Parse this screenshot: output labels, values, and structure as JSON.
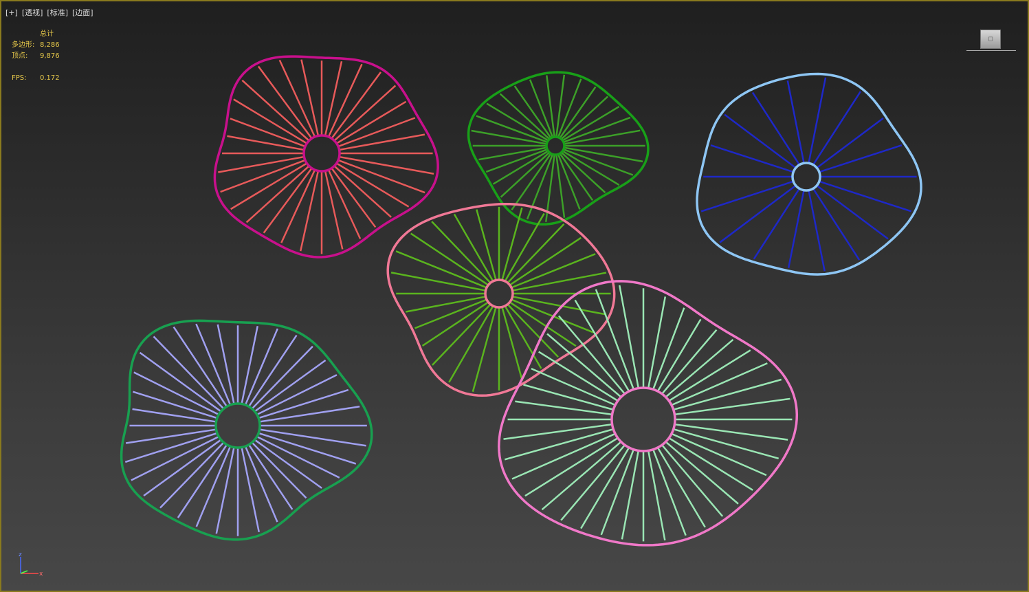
{
  "viewport": {
    "labels": [
      "[+]",
      "[透视]",
      "[标准]",
      "[边面]"
    ],
    "border_color": "#8a7a1e"
  },
  "stats": {
    "header": "总计",
    "polygons_label": "多边形:",
    "polygons_value": "8,286",
    "vertices_label": "顶点:",
    "vertices_value": "9,876",
    "fps_label": "FPS:",
    "fps_value": "0.172",
    "color": "#e6c84a"
  },
  "viewcube": {
    "icon": "viewcube-icon"
  },
  "axis_gizmo": {
    "icon": "axis-tripod-icon",
    "z_label": "z",
    "x_label": "x"
  },
  "objects": [
    {
      "name": "lotus-leaf-red",
      "outline_color": "#c8108c",
      "spoke_color": "#e85a5a",
      "spokes": 32
    },
    {
      "name": "lotus-leaf-green",
      "outline_color": "#18a018",
      "spoke_color": "#3ca028",
      "spokes": 30
    },
    {
      "name": "lotus-leaf-blue",
      "outline_color": "#8ec6f4",
      "spoke_color": "#1e28c8",
      "spokes": 18
    },
    {
      "name": "lotus-leaf-pink",
      "outline_color": "#f07896",
      "spoke_color": "#5ab41e",
      "spokes": 28
    },
    {
      "name": "lotus-leaf-purple",
      "outline_color": "#18a050",
      "spoke_color": "#a0a0f0",
      "spokes": 36
    },
    {
      "name": "lotus-leaf-mint",
      "outline_color": "#f078c8",
      "spoke_color": "#9ae6b4",
      "spokes": 40
    }
  ]
}
